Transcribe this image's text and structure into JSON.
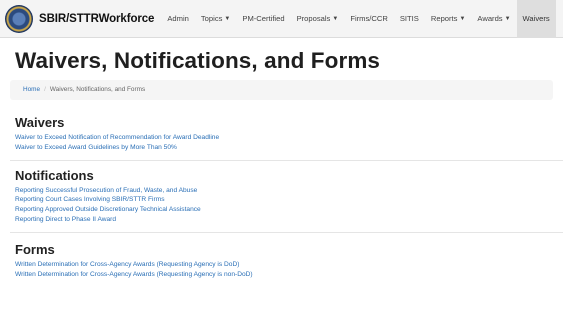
{
  "nav": {
    "brand": "SBIR/STTRWorkforce",
    "items": [
      {
        "label": "Admin",
        "caret": ""
      },
      {
        "label": "Topics",
        "caret": "▼"
      },
      {
        "label": "PM-Certified",
        "caret": ""
      },
      {
        "label": "Proposals",
        "caret": "▼"
      },
      {
        "label": "Firms/CCR",
        "caret": ""
      },
      {
        "label": "SITIS",
        "caret": ""
      },
      {
        "label": "Reports",
        "caret": "▼"
      },
      {
        "label": "Awards",
        "caret": "▼"
      },
      {
        "label": "Waivers",
        "caret": ""
      }
    ]
  },
  "page": {
    "title": "Waivers, Notifications, and Forms"
  },
  "breadcrumb": {
    "home": "Home",
    "separator": "/",
    "current": "Waivers, Notifications, and Forms"
  },
  "sections": {
    "waivers": {
      "heading": "Waivers",
      "links": [
        "Waiver to Exceed Notification of Recommendation for Award Deadline",
        "Waiver to Exceed Award Guidelines by More Than 50%"
      ]
    },
    "notifications": {
      "heading": "Notifications",
      "links": [
        "Reporting Successful Prosecution of Fraud, Waste, and Abuse",
        "Reporting Court Cases Involving SBIR/STTR Firms",
        "Reporting Approved Outside Discretionary Technical Assistance",
        "Reporting Direct to Phase II Award"
      ]
    },
    "forms": {
      "heading": "Forms",
      "links": [
        "Written Determination for Cross-Agency Awards (Requesting Agency is DoD)",
        "Written Determination for Cross-Agency Awards (Requesting Agency is non-DoD)"
      ]
    }
  },
  "colors": {
    "link": "#2a6fb6",
    "navbar_bg": "#f4f4f4",
    "active_nav_bg": "#dedede"
  }
}
